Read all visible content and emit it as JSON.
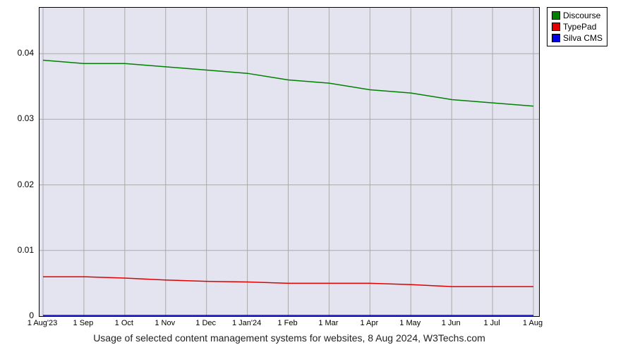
{
  "chart_data": {
    "type": "line",
    "title": "",
    "caption": "Usage of selected content management systems for websites, 8 Aug 2024, W3Techs.com",
    "xlabel": "",
    "ylabel": "",
    "ylim": [
      0,
      0.047
    ],
    "yticks": [
      0,
      0.01,
      0.02,
      0.03,
      0.04
    ],
    "ytick_labels": [
      "0",
      "0.01",
      "0.02",
      "0.03",
      "0.04"
    ],
    "categories": [
      "1 Aug'23",
      "1 Sep",
      "1 Oct",
      "1 Nov",
      "1 Dec",
      "1 Jan'24",
      "1 Feb",
      "1 Mar",
      "1 Apr",
      "1 May",
      "1 Jun",
      "1 Jul",
      "1 Aug"
    ],
    "series": [
      {
        "name": "Discourse",
        "color": "#008000",
        "values": [
          0.039,
          0.0385,
          0.0385,
          0.038,
          0.0375,
          0.037,
          0.036,
          0.0355,
          0.0345,
          0.034,
          0.033,
          0.0325,
          0.032
        ]
      },
      {
        "name": "TypePad",
        "color": "#e00000",
        "values": [
          0.006,
          0.006,
          0.0058,
          0.0055,
          0.0053,
          0.0052,
          0.005,
          0.005,
          0.005,
          0.0048,
          0.0045,
          0.0045,
          0.0045
        ]
      },
      {
        "name": "Silva CMS",
        "color": "#0000e0",
        "values": [
          0.0001,
          0.0001,
          0.0001,
          0.0001,
          0.0001,
          0.0001,
          0.0001,
          0.0001,
          0.0001,
          0.0001,
          0.0001,
          0.0001,
          0.0001
        ]
      }
    ],
    "legend_position": "right"
  }
}
